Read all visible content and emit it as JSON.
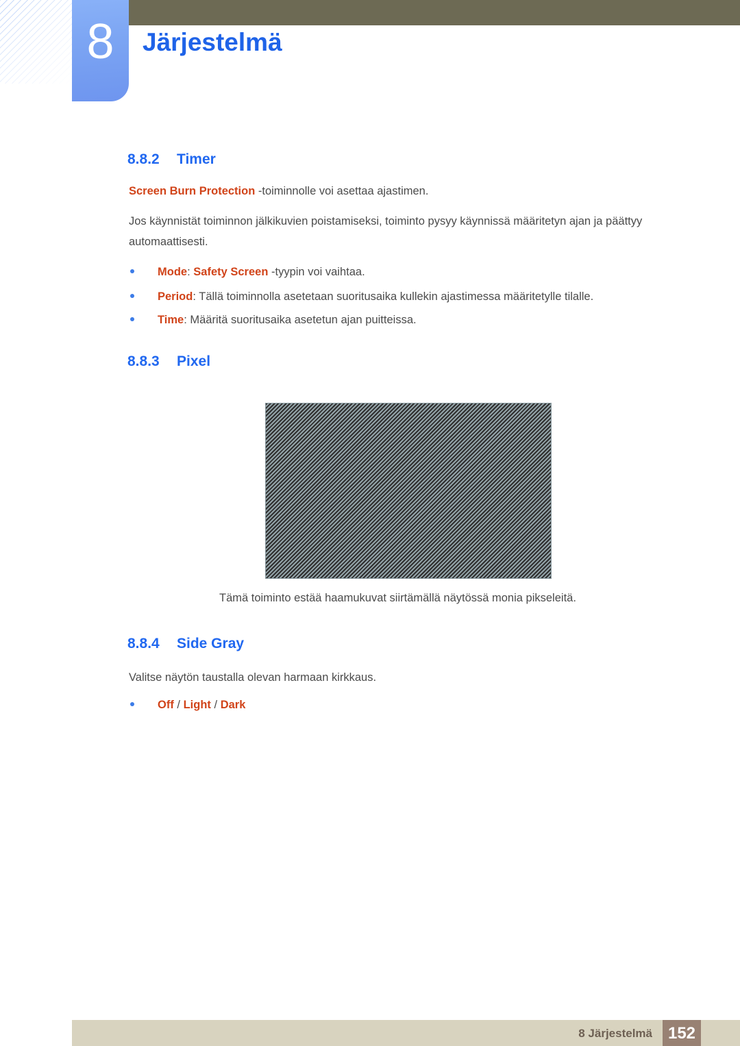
{
  "header": {
    "chapter_number": "8",
    "chapter_title": "Järjestelmä",
    "bar_color": "#6d6a54",
    "badge_color": "#7ca5f3",
    "title_color": "#1f63e8"
  },
  "sections": {
    "timer": {
      "number": "8.8.2",
      "title": "Timer",
      "intro_keyword": "Screen Burn Protection",
      "intro_rest": " -toiminnolle voi asettaa ajastimen.",
      "body_line1": "Jos käynnistät toiminnon jälkikuvien poistamiseksi, toiminto pysyy käynnissä määritetyn ajan ja päättyy",
      "body_line2": "automaattisesti.",
      "bullets": [
        {
          "term": "Mode",
          "sep": ": ",
          "term2": "Safety Screen",
          "rest": " -tyypin voi vaihtaa."
        },
        {
          "term": "Period",
          "sep": ": ",
          "term2": "",
          "rest": "Tällä toiminnolla asetetaan suoritusaika kullekin ajastimessa määritetylle tilalle."
        },
        {
          "term": "Time",
          "sep": ": ",
          "term2": "",
          "rest": "Määritä suoritusaika asetetun ajan puitteissa."
        }
      ]
    },
    "pixel": {
      "number": "8.8.3",
      "title": "Pixel",
      "figure_name": "diagonal-hatch-pattern",
      "figure_bg_color": "#93a3a8",
      "figure_stripe_color": "#2f2f2f",
      "caption": "Tämä toiminto estää haamukuvat siirtämällä näytössä monia pikseleitä."
    },
    "side_gray": {
      "number": "8.8.4",
      "title": "Side Gray",
      "body": "Valitse näytön taustalla olevan harmaan kirkkaus.",
      "options": {
        "opt1": "Off",
        "slash1": " / ",
        "opt2": "Light",
        "slash2": " / ",
        "opt3": "Dark"
      }
    }
  },
  "footer": {
    "label": "8 Järjestelmä",
    "page_number": "152",
    "bar_color": "#d8d3bf",
    "page_box_color": "#988173"
  }
}
